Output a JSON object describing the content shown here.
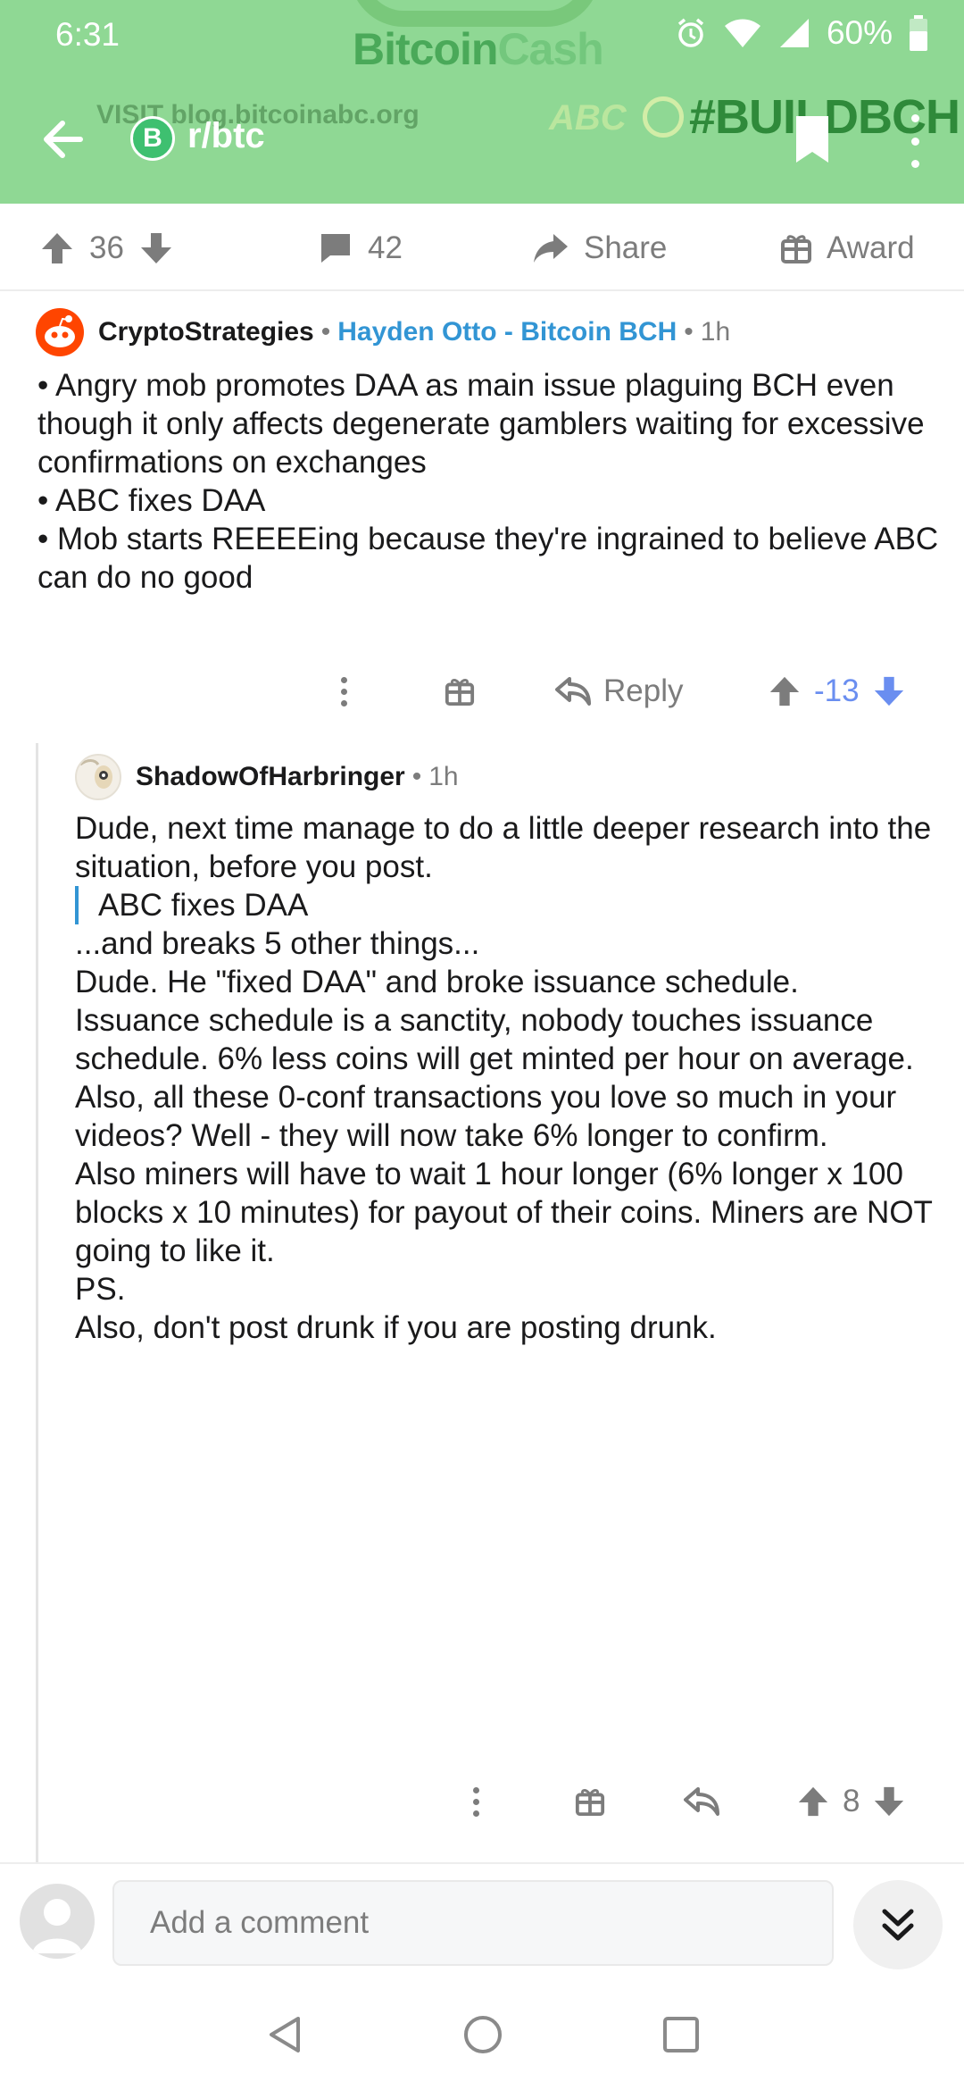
{
  "status_bar": {
    "time": "6:31",
    "battery": "60%"
  },
  "banner": {
    "brand_part1": "Bitcoin",
    "brand_part2": "Cash",
    "visit_text": "VISIT blog.bitcoinabc.org",
    "abc_text": "ABC",
    "hashtag": "#BUILDBCH"
  },
  "app_bar": {
    "subreddit": "r/btc",
    "subreddit_icon_glyph": "B"
  },
  "post_actions": {
    "score": "36",
    "comments": "42",
    "share_label": "Share",
    "award_label": "Award"
  },
  "comments": [
    {
      "author": "CryptoStrategies",
      "flair": "Hayden Otto - Bitcoin BCH",
      "time": "1h",
      "body": [
        "• Angry mob promotes DAA as main issue plaguing BCH even though it only affects degenerate gamblers waiting for excessive confirmations on exchanges",
        "• ABC fixes DAA",
        "• Mob starts REEEEing because they're ingrained to believe ABC can do no good"
      ],
      "reply_label": "Reply",
      "score": "-13"
    },
    {
      "author": "ShadowOfHarbringer",
      "time": "1h",
      "intro": "Dude, next time manage to do a little deeper research into the situation, before you post.",
      "quote": "ABC fixes DAA",
      "paragraphs": [
        "...and breaks 5 other things...",
        "Dude. He \"fixed DAA\" and broke issuance schedule.",
        "Issuance schedule is a sanctity, nobody touches issuance schedule. 6% less coins will get minted per hour on average.",
        "Also, all these 0-conf transactions you love so much in your videos? Well - they will now take 6% longer to confirm.",
        "Also miners will have to wait 1 hour longer (6% longer x 100 blocks x 10 minutes) for payout of their coins. Miners are NOT going to like it.",
        "PS.",
        "Also, don't post drunk if you are posting drunk."
      ],
      "score": "8"
    }
  ],
  "composer": {
    "placeholder": "Add a comment"
  },
  "colors": {
    "banner_bg": "#8fd894",
    "flair": "#3295d4",
    "downvote": "#6a8ef0",
    "text": "#1a1a1b",
    "meta": "#7c7c7c"
  }
}
